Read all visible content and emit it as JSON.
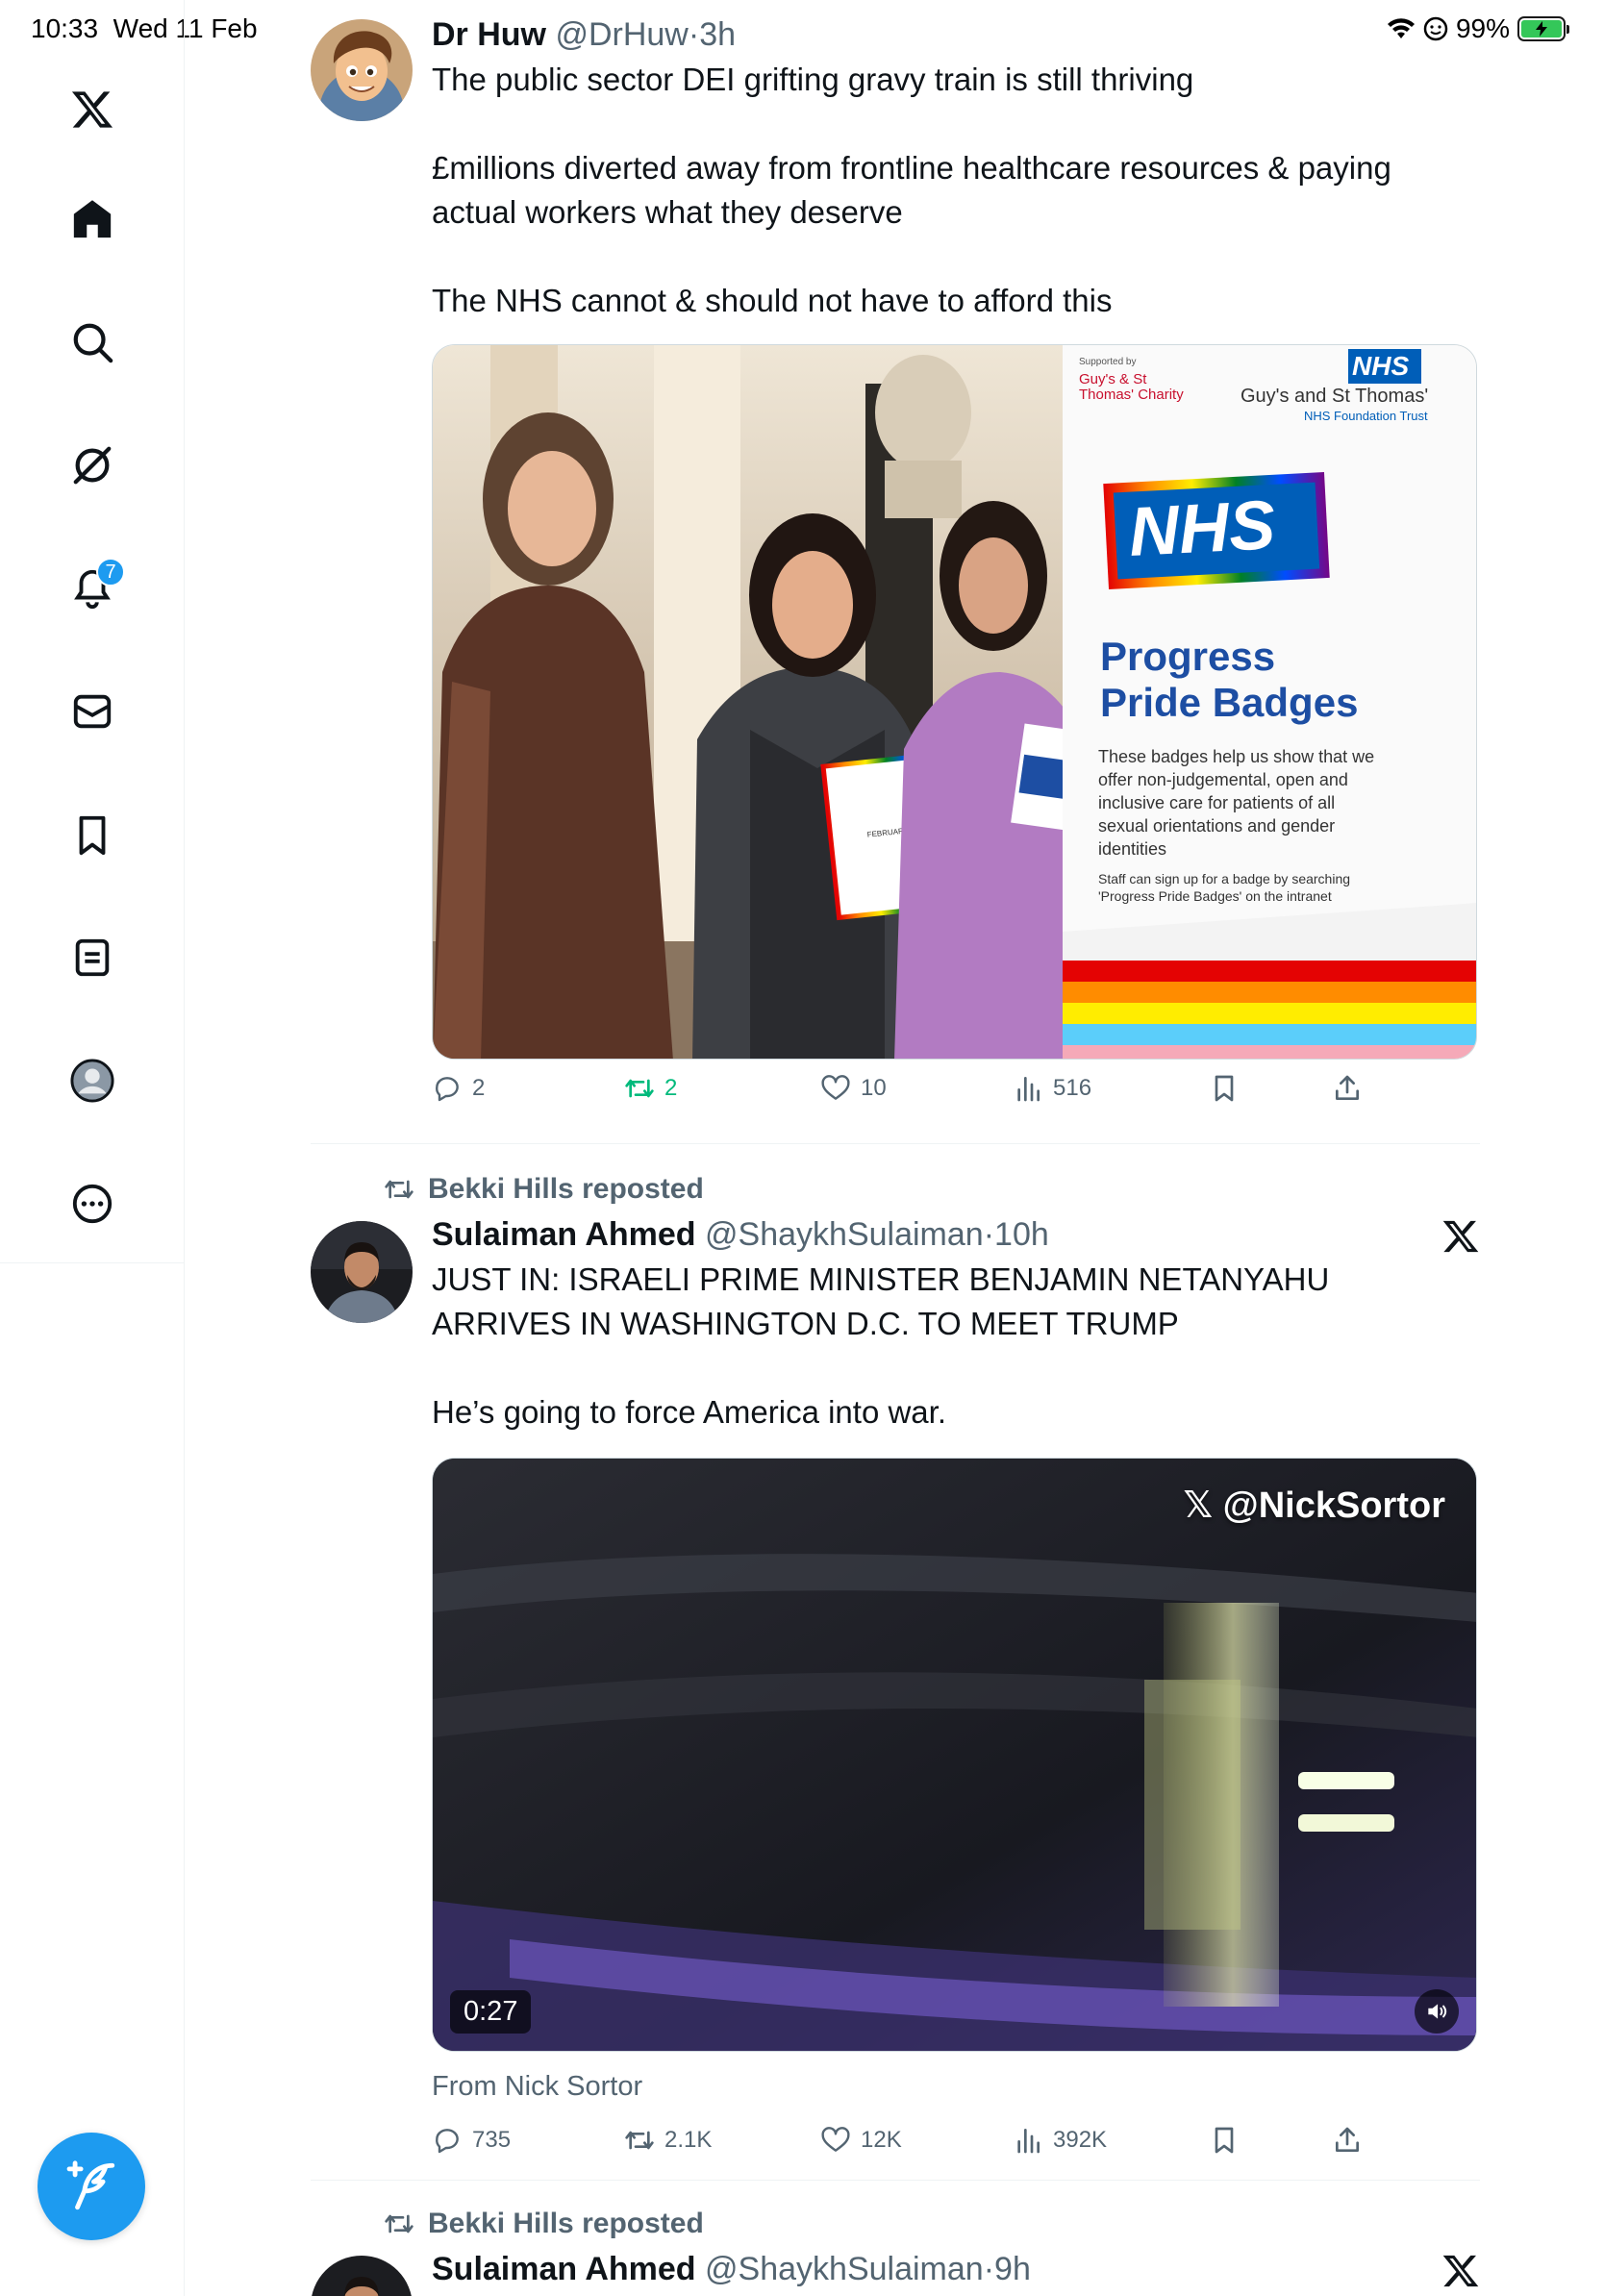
{
  "status_bar": {
    "time": "10:33",
    "date": "Wed 11 Feb",
    "battery": "99%"
  },
  "sidebar": {
    "notification_count": "7",
    "icons": [
      "x-logo-icon",
      "home-icon",
      "search-icon",
      "grok-icon",
      "bell-icon",
      "mail-icon",
      "bookmark-icon",
      "list-icon",
      "profile-icon",
      "more-icon",
      "compose-icon"
    ]
  },
  "tweets": [
    {
      "name": "Dr Huw",
      "handle": "@DrHuw",
      "dot": "·",
      "time": "3h",
      "text": "The public sector DEI grifting gravy train is still thriving\n\n£millions diverted away from frontline healthcare resources & paying actual workers what they deserve\n\nThe NHS cannot & should not have to afford this",
      "media": {
        "banner_supported_by": "Supported by",
        "banner_charity": "Guy's & St Thomas' Charity",
        "banner_nhs": "NHS",
        "banner_trust": "Guy's and St Thomas'",
        "banner_trust_sub": "NHS Foundation Trust",
        "banner_logo": "NHS",
        "banner_title_1": "Progress",
        "banner_title_2": "Pride Badges",
        "banner_body": "These badges help us show that we offer non-judgemental, open and inclusive care for patients of all sexual orientations and gender identities",
        "banner_staff": "Staff can sign up for a badge by searching 'Progress Pride Badges' on the intranet",
        "certificate_text": "FEBRUARY LGBT+ HISTORY MONTH"
      },
      "replies": "2",
      "reposts": "2",
      "likes": "10",
      "views": "516"
    },
    {
      "repost_by": "Bekki Hills reposted",
      "name": "Sulaiman Ahmed",
      "handle": "@ShaykhSulaiman",
      "dot": "·",
      "time": "10h",
      "text": "JUST IN: ISRAELI PRIME MINISTER BENJAMIN NETANYAHU ARRIVES IN WASHINGTON D.C. TO MEET TRUMP\n\nHe’s going to force America into war.",
      "video": {
        "watermark": "@NickSortor",
        "duration": "0:27"
      },
      "from": "From Nick Sortor",
      "replies": "735",
      "reposts": "2.1K",
      "likes": "12K",
      "views": "392K"
    },
    {
      "repost_by": "Bekki Hills reposted",
      "name": "Sulaiman Ahmed",
      "handle": "@ShaykhSulaiman",
      "dot": "·",
      "time": "9h"
    }
  ],
  "colors": {
    "accent": "#1d9bf0",
    "repost_green": "#00ba7c",
    "muted": "#536471",
    "text": "#0f1419"
  }
}
